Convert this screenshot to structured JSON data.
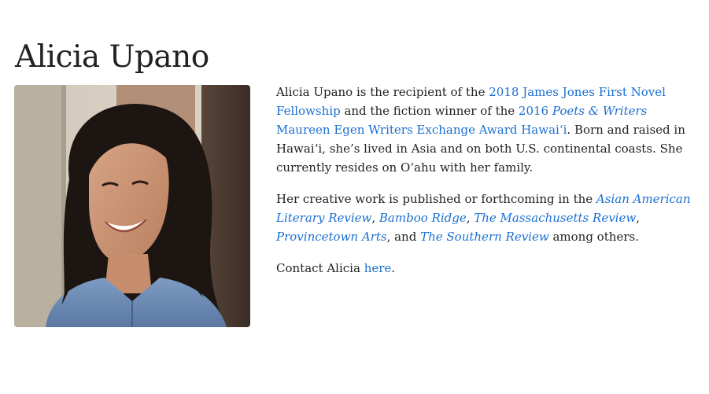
{
  "page": {
    "title": "Alicia Upano"
  },
  "photo": {
    "alt": "Portrait of Alicia Upano"
  },
  "bio": {
    "p1": {
      "t1": "Alicia Upano is the recipient of the ",
      "link1": "2018 James Jones First Novel Fellowship",
      "t2": " and the fiction winner of the ",
      "link2_a": "2016 ",
      "link2_em": "Poets & Writers",
      "link2_b": " Maureen Egen Writers Exchange Award Hawai‘i",
      "t3": ". Born and raised in Hawai‘i, she’s lived in Asia and on both U.S. continental coasts. She currently resides on O‘ahu with her family."
    },
    "p2": {
      "t1": "Her creative work is published or forthcoming in the ",
      "pub1": "Asian American Literary Review",
      "sep1": ", ",
      "pub2": "Bamboo Ridge",
      "sep2": ", ",
      "pub3": "The Massachusetts Review",
      "sep3": ", ",
      "pub4": "Provincetown Arts",
      "sep4": ", and ",
      "pub5": "The Southern Review",
      "t2": " among others."
    },
    "p3": {
      "t1": "Contact Alicia ",
      "link": "here",
      "t2": "."
    }
  },
  "colors": {
    "link": "#1a6fd1",
    "text": "#222222"
  }
}
